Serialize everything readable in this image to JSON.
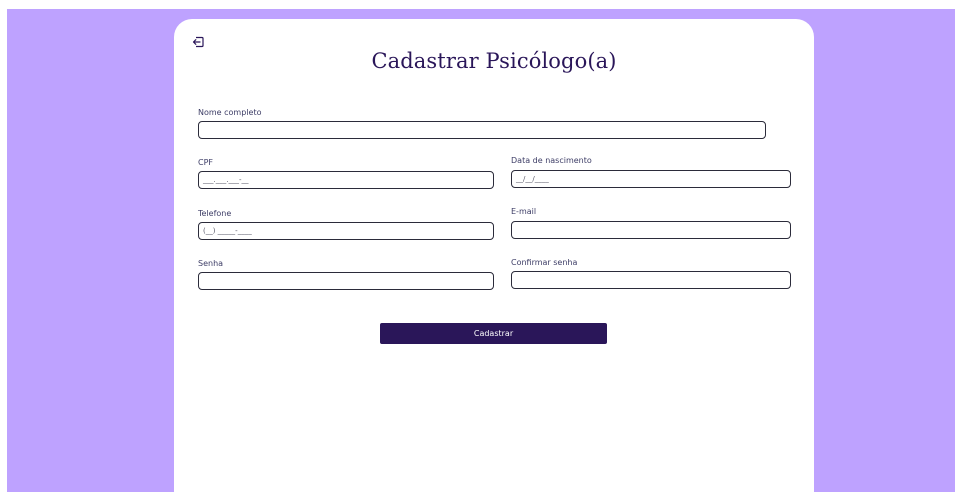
{
  "page": {
    "title": "Cadastrar Psicólogo(a)",
    "back_icon": "exit-arrow-icon"
  },
  "form": {
    "fields": {
      "nome_completo": {
        "label": "Nome completo",
        "value": ""
      },
      "cpf": {
        "label": "CPF",
        "value": "___.___.___-__"
      },
      "data_nascimento": {
        "label": "Data de nascimento",
        "value": "__/__/____"
      },
      "telefone": {
        "label": "Telefone",
        "value": "(__) _____-____"
      },
      "email": {
        "label": "E-mail",
        "value": ""
      },
      "senha": {
        "label": "Senha",
        "value": ""
      },
      "confirmar_senha": {
        "label": "Confirmar senha",
        "value": ""
      }
    },
    "submit_label": "Cadastrar"
  },
  "colors": {
    "background": "#bea2ff",
    "card": "#ffffff",
    "primary": "#2a1659"
  }
}
